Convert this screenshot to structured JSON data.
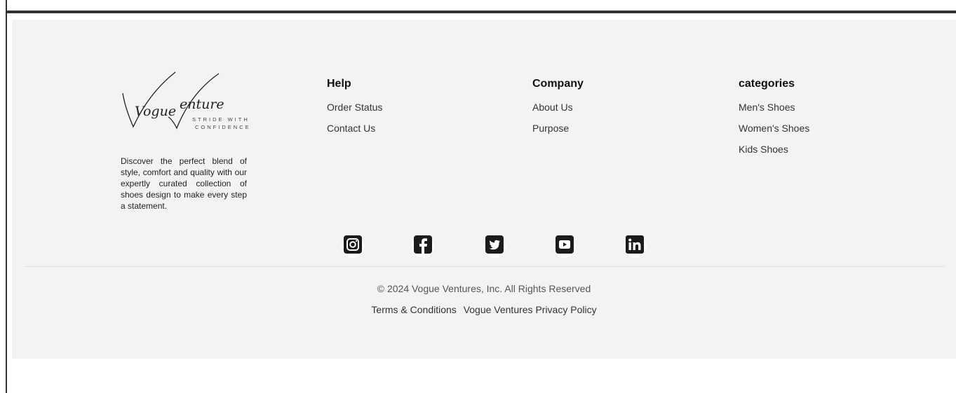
{
  "brand": {
    "name_part1": "Vogue",
    "name_part2": "enture",
    "motto_line1": "STRIDE WITH",
    "motto_line2": "CONFIDENCE",
    "tagline": "Discover the perfect blend of style, comfort and quality with our expertly curated collection of shoes design to make every step a statement."
  },
  "columns": {
    "help": {
      "title": "Help",
      "links": [
        "Order Status",
        "Contact Us"
      ]
    },
    "company": {
      "title": "Company",
      "links": [
        "About Us",
        "Purpose"
      ]
    },
    "categories": {
      "title": "categories",
      "links": [
        "Men's Shoes",
        "Women's Shoes",
        "Kids Shoes"
      ]
    }
  },
  "social": [
    "instagram-icon",
    "facebook-icon",
    "twitter-icon",
    "youtube-icon",
    "linkedin-icon"
  ],
  "copyright": "© 2024 Vogue Ventures, Inc. All Rights Reserved",
  "legal": {
    "terms": "Terms & Conditions",
    "privacy": "Vogue Ventures Privacy Policy"
  }
}
